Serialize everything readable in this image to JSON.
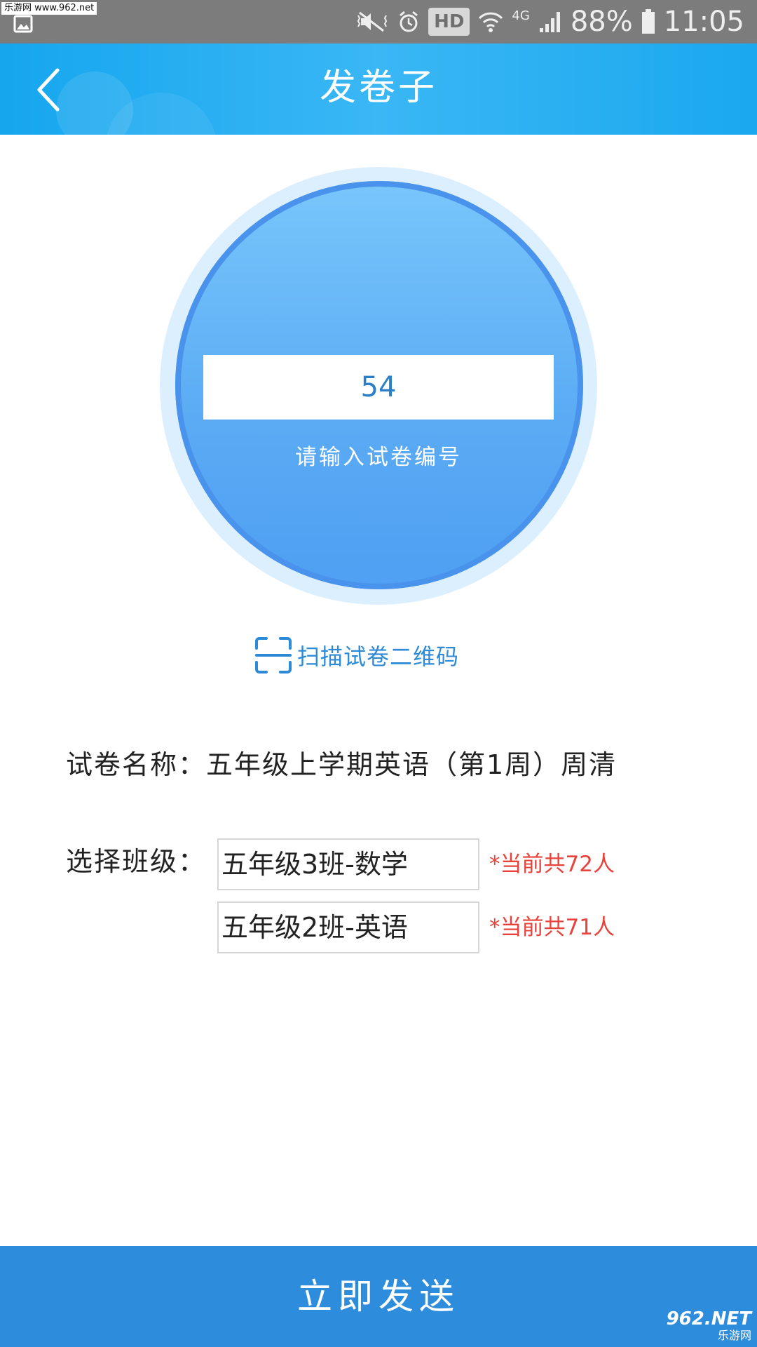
{
  "status_bar": {
    "watermark": "乐游网 www.962.net",
    "hd_label": "HD",
    "network_label": "4G",
    "battery": "88%",
    "time": "11:05"
  },
  "header": {
    "title": "发卷子"
  },
  "paper_input": {
    "value": "54",
    "hint": "请输入试卷编号"
  },
  "scan": {
    "label": "扫描试卷二维码"
  },
  "paper_name": {
    "text": "试卷名称：五年级上学期英语（第1周）周清"
  },
  "class_select": {
    "label": "选择班级：",
    "options": [
      {
        "name": "五年级3班-数学",
        "count": "*当前共72人"
      },
      {
        "name": "五年级2班-英语",
        "count": "*当前共71人"
      }
    ]
  },
  "footer": {
    "send_label": "立即发送"
  },
  "brand": {
    "logo": "962.NET",
    "sub": "乐游网"
  },
  "colors": {
    "header": "#15a6ee",
    "button": "#2d8cdb",
    "circle": "#5aaaf4",
    "count_text": "#e8423a",
    "link": "#2c8ad6"
  }
}
